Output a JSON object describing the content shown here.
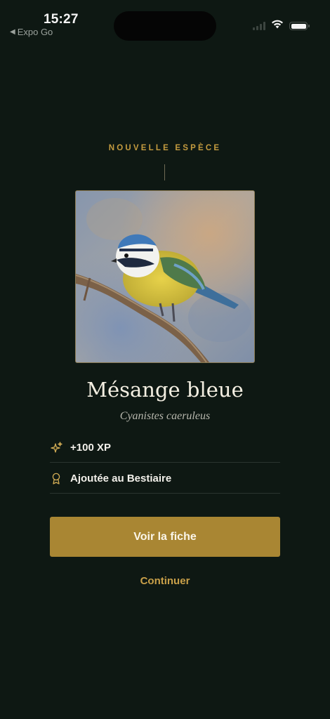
{
  "status_bar": {
    "time": "15:27",
    "back_app": "Expo Go",
    "back_icon": "back-triangle-icon",
    "icons": [
      "signal-icon",
      "wifi-icon",
      "battery-icon"
    ]
  },
  "discovery": {
    "kicker": "NOUVELLE ESPÈCE",
    "photo_subject": "blue-tit-photo",
    "species_name": "Mésange bleue",
    "latin_name": "Cyanistes caeruleus",
    "rewards": [
      {
        "icon": "sparkle-icon",
        "label": "+100 XP"
      },
      {
        "icon": "award-ribbon-icon",
        "label": "Ajoutée au Bestiaire"
      }
    ],
    "primary_button": "Voir la fiche",
    "secondary_button": "Continuer"
  },
  "colors": {
    "background": "#0e1813",
    "accent_gold": "#a98633",
    "kicker_gold": "#c49b3f",
    "link_gold": "#c9a049",
    "text_light": "#f4efe2"
  }
}
